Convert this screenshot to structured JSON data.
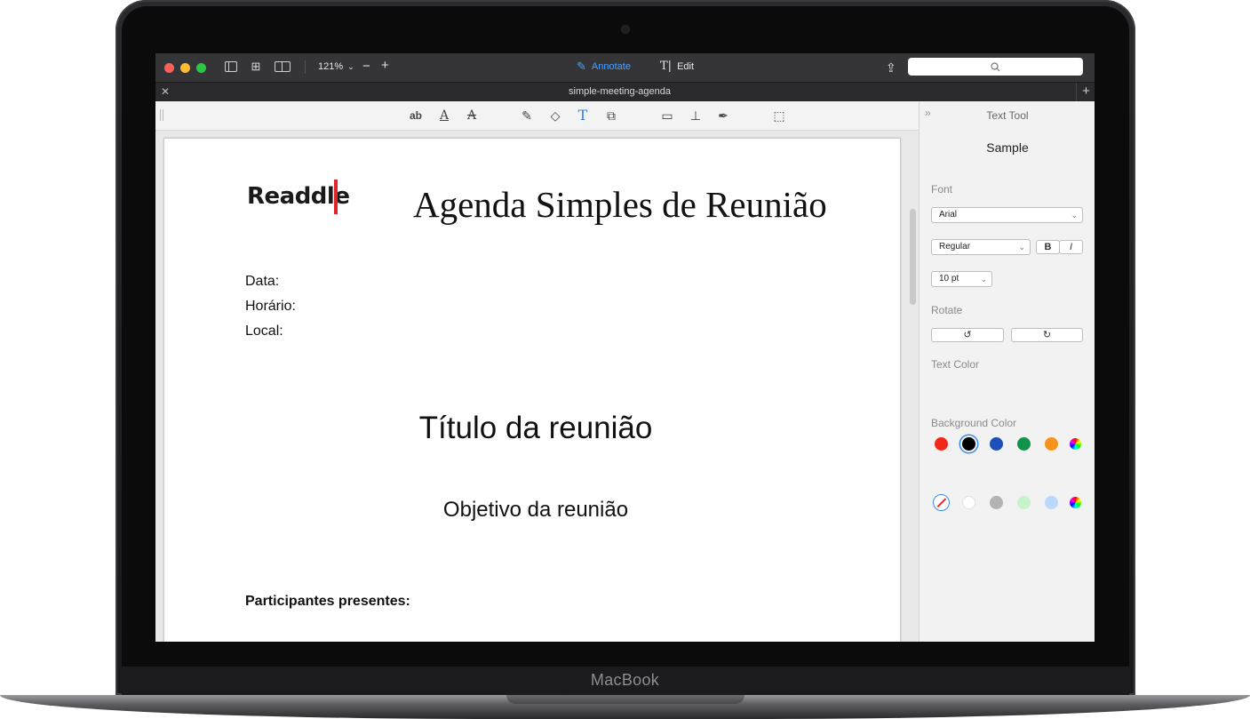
{
  "device": {
    "brand": "MacBook"
  },
  "window": {
    "zoom": "121%",
    "mode_annotate": "Annotate",
    "mode_edit": "Edit",
    "tab_title": "simple-meeting-agenda",
    "search_placeholder": ""
  },
  "document": {
    "logo_text": "Readdle",
    "title": "Agenda Simples de Reunião",
    "fields": [
      "Data:",
      "Horário:",
      "Local:"
    ],
    "meeting_title": "Título da reunião",
    "objective": "Objetivo da reunião",
    "participants_label": "Participantes presentes:"
  },
  "panel": {
    "header": "Text Tool",
    "sample": "Sample",
    "font_label": "Font",
    "font_value": "Arial",
    "style_value": "Regular",
    "bold_label": "B",
    "italic_label": "I",
    "size_value": "10 pt",
    "rotate_label": "Rotate",
    "text_color_label": "Text Color",
    "text_colors": [
      "#f1291a",
      "#000000",
      "#1e4fb8",
      "#10934a",
      "#f7931d"
    ],
    "text_color_selected": "#000000",
    "background_color_label": "Background Color",
    "background_colors": [
      "none",
      "#ffffff",
      "#b3b3b3",
      "#c8f2c9",
      "#bcd9fb"
    ]
  }
}
